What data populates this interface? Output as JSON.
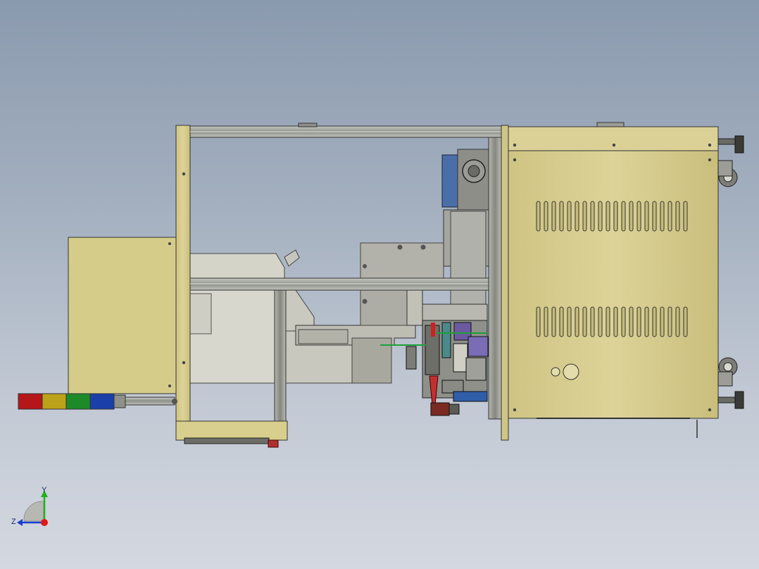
{
  "triad": {
    "y_label": "Y",
    "z_label": "Z"
  },
  "colors": {
    "frame": "#d9cf8e",
    "frame_dark": "#b8ad6c",
    "steel": "#a9aba5",
    "dark_steel": "#6f716c",
    "axis_y": "#22b022",
    "axis_z": "#1a3fd0",
    "axis_x": "#e01818"
  },
  "stack_light": {
    "segments": [
      "red",
      "yellow",
      "green",
      "blue"
    ]
  }
}
